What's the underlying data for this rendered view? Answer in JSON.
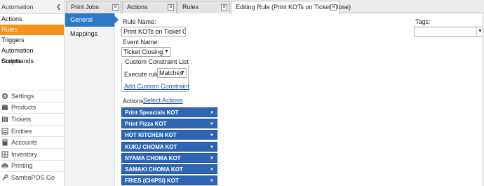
{
  "left_nav": {
    "header": "Automation",
    "items": [
      "Actions",
      "Rules",
      "Triggers",
      "Automation Commands",
      "Scripts"
    ],
    "active": "Rules",
    "bottom": [
      {
        "label": "Settings",
        "icon": "gear-icon"
      },
      {
        "label": "Products",
        "icon": "products-icon"
      },
      {
        "label": "Tickets",
        "icon": "tickets-icon"
      },
      {
        "label": "Entities",
        "icon": "entities-icon"
      },
      {
        "label": "Accounts",
        "icon": "accounts-icon"
      },
      {
        "label": "Inventory",
        "icon": "inventory-icon"
      },
      {
        "label": "Printing",
        "icon": "printer-icon"
      },
      {
        "label": "SambaPOS Go",
        "icon": "wrench-icon"
      }
    ]
  },
  "tabs": [
    {
      "label": "Print Jobs"
    },
    {
      "label": "Actions"
    },
    {
      "label": "Rules"
    },
    {
      "label": "Editing Rule (Print KOTs on Ticket Close)"
    }
  ],
  "sub_nav": {
    "items": [
      "General Settings",
      "Mappings"
    ],
    "active": "General Settings"
  },
  "form": {
    "rule_name_label": "Rule Name:",
    "rule_name_value": "Print KOTs on Ticket Close",
    "event_name_label": "Event Name:",
    "event_name_value": "Ticket Closing",
    "constraint_group_label": "Custom Constraint List",
    "execute_rule_label": "Execute rule if",
    "execute_rule_value": "Matches",
    "add_constraint_link": "Add Custom Constraint",
    "actions_label": "Actions:",
    "select_actions_link": "Select Actions",
    "tags_label": "Tags:",
    "tags_value": "",
    "actions": [
      "Print Speacials KOT",
      "Print Pizza KOT",
      "HOT KITCHEN KOT",
      "KUKU CHOMA KOT",
      "NYAMA CHOMA KOT",
      "SAMAKI CHOMA KOT",
      "FRIES (CHIPSI) KOT"
    ]
  },
  "colors": {
    "nav_active": "#f5921e",
    "subnav_active": "#2b78c6",
    "action_button": "#2e66b5",
    "link": "#1a4fb5"
  }
}
